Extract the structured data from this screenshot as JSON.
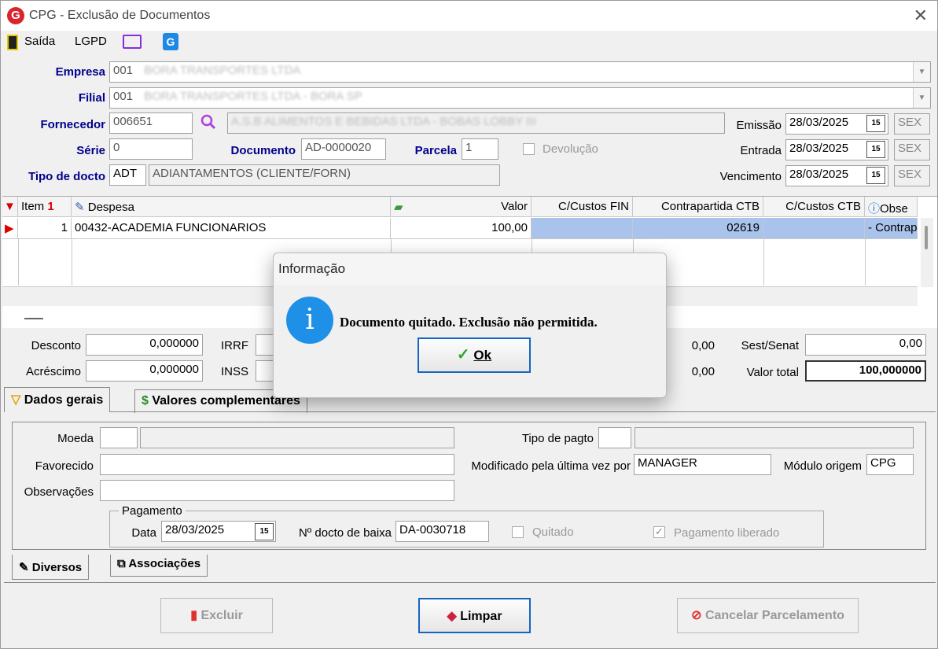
{
  "window": {
    "title": "CPG - Exclusão de Documentos",
    "logo_letter": "G"
  },
  "toolbar": {
    "exit_label": "Saída",
    "lgpd_label": "LGPD"
  },
  "form": {
    "empresa_label": "Empresa",
    "empresa_code": "001",
    "empresa_name": "BORA TRANSPORTES LTDA",
    "filial_label": "Filial",
    "filial_code": "001",
    "filial_name": "BORA TRANSPORTES LTDA - BORA SP",
    "fornecedor_label": "Fornecedor",
    "fornecedor_code": "006651",
    "fornecedor_name": "A.S.B ALIMENTOS E BEBIDAS LTDA - BOBAS LOBBY III",
    "serie_label": "Série",
    "serie_value": "0",
    "documento_label": "Documento",
    "documento_value": "AD-0000020",
    "parcela_label": "Parcela",
    "parcela_value": "1",
    "devolucao_label": "Devolução",
    "tipo_label": "Tipo de docto",
    "tipo_code": "ADT",
    "tipo_name": "ADIANTAMENTOS (CLIENTE/FORN)",
    "emissao_label": "Emissão",
    "emissao_value": "28/03/2025",
    "emissao_dow": "SEX",
    "entrada_label": "Entrada",
    "entrada_value": "28/03/2025",
    "entrada_dow": "SEX",
    "vencimento_label": "Vencimento",
    "vencimento_value": "28/03/2025",
    "vencimento_dow": "SEX",
    "cal_icon_text": "15"
  },
  "grid": {
    "headers": {
      "item": "Item",
      "despesa": "Despesa",
      "valor": "Valor",
      "ccfin": "C/Custos FIN",
      "contrapartida": "Contrapartida CTB",
      "ccctb": "C/Custos CTB",
      "obs": "Obse"
    },
    "row": {
      "item": "1",
      "despesa": "00432-ACADEMIA FUNCIONARIOS",
      "valor": "100,00",
      "ccfin": "",
      "contrapartida": "02619",
      "ccctb": "",
      "obs": "- Contrap"
    }
  },
  "totals": {
    "desconto_label": "Desconto",
    "desconto_value": "0,000000",
    "acrescimo_label": "Acréscimo",
    "acrescimo_value": "0,000000",
    "irrf_label": "IRRF",
    "inss_label": "INSS",
    "mid1_value": "0,00",
    "mid2_value": "0,00",
    "sest_label": "Sest/Senat",
    "sest_value": "0,00",
    "total_label": "Valor total",
    "total_value": "100,000000"
  },
  "tabs": {
    "dados_gerais": "Dados gerais",
    "valores_comp": "Valores complementares"
  },
  "details": {
    "moeda_label": "Moeda",
    "favorecido_label": "Favorecido",
    "obs_label": "Observações",
    "tipo_pagto_label": "Tipo de pagto",
    "modificado_label": "Modificado pela última vez por",
    "modificado_value": "MANAGER",
    "modulo_label": "Módulo origem",
    "modulo_value": "CPG",
    "pagamento_legend": "Pagamento",
    "data_label": "Data",
    "data_value": "28/03/2025",
    "docto_baixa_label": "Nº docto de baixa",
    "docto_baixa_value": "DA-0030718",
    "quitado_label": "Quitado",
    "liberado_label": "Pagamento liberado"
  },
  "bottom_tabs": {
    "diversos": "Diversos",
    "associacoes": "Associações"
  },
  "buttons": {
    "excluir": "Excluir",
    "limpar": "Limpar",
    "cancelar": "Cancelar Parcelamento"
  },
  "dialog": {
    "title": "Informação",
    "message": "Documento quitado. Exclusão não permitida.",
    "ok": "Ok"
  },
  "colors": {
    "accent": "#1565c0",
    "label_blue": "#00008b",
    "info_blue": "#1e90e8",
    "selection": "#a9c3ec"
  }
}
